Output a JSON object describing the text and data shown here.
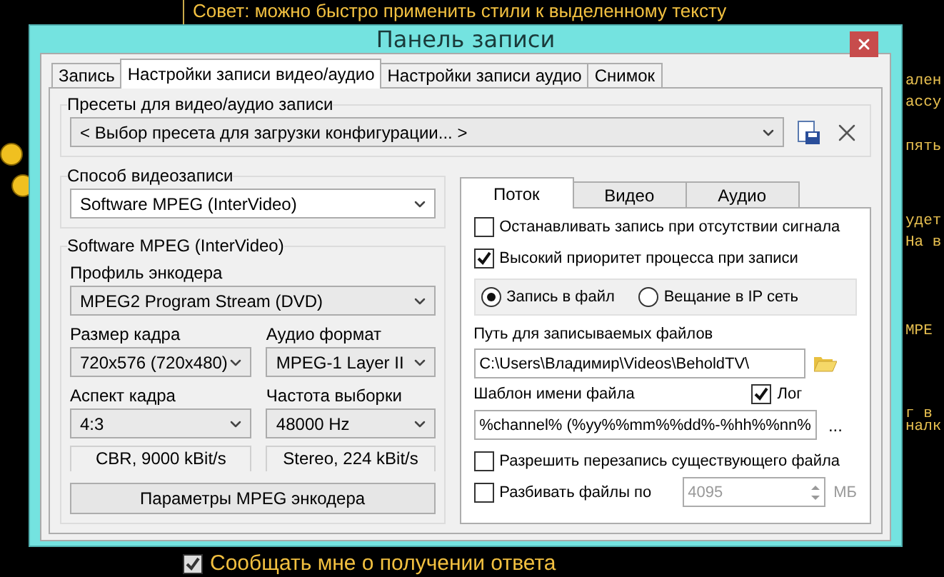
{
  "background": {
    "tip": "Совет: можно быстро применить стили к выделенному тексту",
    "side_fragments": [
      "ален",
      "ассу",
      "пять",
      "удет",
      "На в",
      "МРЕ",
      "г в",
      "налк"
    ],
    "notify": {
      "label": "Сообщать мне о получении ответа",
      "checked": true
    }
  },
  "window": {
    "title": "Панель записи"
  },
  "tabs": [
    {
      "label": "Запись",
      "selected": false
    },
    {
      "label": "Настройки записи видео/аудио",
      "selected": true
    },
    {
      "label": "Настройки записи аудио",
      "selected": false
    },
    {
      "label": "Снимок",
      "selected": false
    }
  ],
  "presets": {
    "legend": "Пресеты для видео/аудио записи",
    "value": "< Выбор пресета для загрузки конфигурации... >"
  },
  "capture": {
    "legend": "Способ видеозаписи",
    "value": "Software MPEG (InterVideo)"
  },
  "encoder": {
    "legend": "Software MPEG (InterVideo)",
    "profile_label": "Профиль энкодера",
    "profile": "MPEG2 Program Stream (DVD)",
    "fields": [
      {
        "label": "Размер кадра",
        "value": "720x576 (720x480)"
      },
      {
        "label": "Аудио формат",
        "value": "MPEG-1 Layer II"
      },
      {
        "label": "Аспект кадра",
        "value": "4:3"
      },
      {
        "label": "Частота выборки",
        "value": "48000 Hz"
      }
    ],
    "video_info": "CBR, 9000 kBit/s",
    "audio_info": "Stereo, 224 kBit/s",
    "button": "Параметры MPEG энкодера"
  },
  "sub_tabs": [
    {
      "label": "Поток",
      "selected": true
    },
    {
      "label": "Видео",
      "selected": false
    },
    {
      "label": "Аудио",
      "selected": false
    }
  ],
  "stream": {
    "options": [
      {
        "label": "Останавливать запись при отсутствии сигнала",
        "checked": false
      },
      {
        "label": "Высокий приоритет процесса при записи",
        "checked": true
      }
    ],
    "targets": [
      {
        "label": "Запись в файл",
        "selected": true
      },
      {
        "label": "Вещание в IP сеть",
        "selected": false
      }
    ],
    "path_label": "Путь для записываемых файлов",
    "path": "C:\\Users\\Владимир\\Videos\\BeholdTV\\",
    "template_label": "Шаблон имени файла",
    "log": {
      "label": "Лог",
      "checked": true
    },
    "template": "%channel% (%yy%%mm%%dd%-%hh%%nn%",
    "browse": "...",
    "overwrite": {
      "label": "Разрешить перезапись существующего файла",
      "checked": false
    },
    "split": {
      "label": "Разбивать файлы по",
      "checked": false,
      "size": "4095",
      "unit": "МБ"
    }
  }
}
